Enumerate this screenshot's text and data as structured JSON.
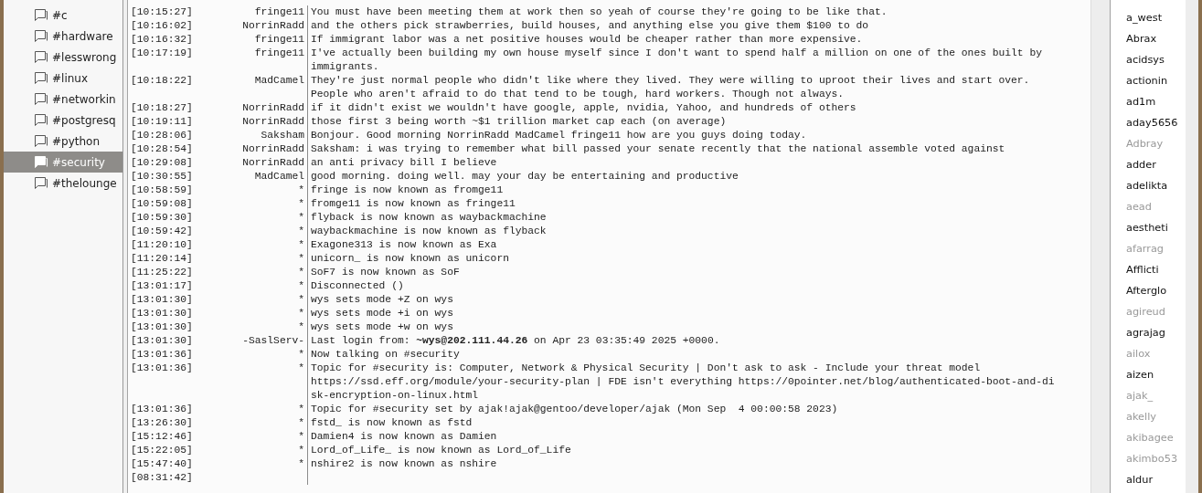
{
  "channels": [
    {
      "name": "#c",
      "selected": false
    },
    {
      "name": "#hardware",
      "selected": false
    },
    {
      "name": "#lesswrong",
      "selected": false
    },
    {
      "name": "#linux",
      "selected": false
    },
    {
      "name": "#networkin",
      "selected": false
    },
    {
      "name": "#postgresq",
      "selected": false
    },
    {
      "name": "#python",
      "selected": false
    },
    {
      "name": "#security",
      "selected": true
    },
    {
      "name": "#thelounge",
      "selected": false
    }
  ],
  "messages": [
    {
      "time": "[10:15:27]",
      "nick": "fringe11",
      "lines": [
        "You must have been meeting them at work then so yeah of course they're going to be like that."
      ]
    },
    {
      "time": "[10:16:02]",
      "nick": "NorrinRadd",
      "lines": [
        "and the others pick strawberries, build houses, and anything else you give them $100 to do"
      ]
    },
    {
      "time": "[10:16:32]",
      "nick": "fringe11",
      "lines": [
        "If immigrant labor was a net positive houses would be cheaper rather than more expensive."
      ]
    },
    {
      "time": "[10:17:19]",
      "nick": "fringe11",
      "lines": [
        "I've actually been building my own house myself since I don't want to spend half a million on one of the ones built by",
        "immigrants."
      ]
    },
    {
      "time": "[10:18:22]",
      "nick": "MadCamel",
      "lines": [
        "They're just normal people who didn't like where they lived. They were willing to uproot their lives and start over.",
        "People who aren't afraid to do that tend to be tough, hard workers. Though not always."
      ]
    },
    {
      "time": "[10:18:27]",
      "nick": "NorrinRadd",
      "lines": [
        "if it didn't exist we wouldn't have google, apple, nvidia, Yahoo, and hundreds of others"
      ]
    },
    {
      "time": "[10:19:11]",
      "nick": "NorrinRadd",
      "lines": [
        "those first 3 being worth ~$1 trillion market cap each (on average)"
      ]
    },
    {
      "time": "[10:28:06]",
      "nick": "Saksham",
      "lines": [
        "Bonjour. Good morning NorrinRadd MadCamel fringe11 how are you guys doing today."
      ]
    },
    {
      "time": "[10:28:54]",
      "nick": "NorrinRadd",
      "lines": [
        "Saksham: i was trying to remember what bill passed your senate recently that the national assemble voted against"
      ]
    },
    {
      "time": "[10:29:08]",
      "nick": "NorrinRadd",
      "lines": [
        "an anti privacy bill I believe"
      ]
    },
    {
      "time": "[10:30:55]",
      "nick": "MadCamel",
      "lines": [
        "good morning. doing well. may your day be entertaining and productive"
      ]
    },
    {
      "time": "[10:58:59]",
      "nick": "*",
      "lines": [
        "fringe is now known as fromge11"
      ]
    },
    {
      "time": "[10:59:08]",
      "nick": "*",
      "lines": [
        "fromge11 is now known as fringe11"
      ]
    },
    {
      "time": "[10:59:30]",
      "nick": "*",
      "lines": [
        "flyback is now known as waybackmachine"
      ]
    },
    {
      "time": "[10:59:42]",
      "nick": "*",
      "lines": [
        "waybackmachine is now known as flyback"
      ]
    },
    {
      "time": "[11:20:10]",
      "nick": "*",
      "lines": [
        "Exagone313 is now known as Exa"
      ]
    },
    {
      "time": "[11:20:14]",
      "nick": "*",
      "lines": [
        "unicorn_ is now known as unicorn"
      ]
    },
    {
      "time": "[11:25:22]",
      "nick": "*",
      "lines": [
        "SoF7 is now known as SoF"
      ]
    },
    {
      "time": "[13:01:17]",
      "nick": "*",
      "lines": [
        "Disconnected ()"
      ]
    },
    {
      "time": "[13:01:30]",
      "nick": "*",
      "lines": [
        "wys sets mode +Z on wys"
      ]
    },
    {
      "time": "[13:01:30]",
      "nick": "*",
      "lines": [
        "wys sets mode +i on wys"
      ]
    },
    {
      "time": "[13:01:30]",
      "nick": "*",
      "lines": [
        "wys sets mode +w on wys"
      ]
    },
    {
      "time": "[13:01:30]",
      "nick": "-SaslServ-",
      "lines": [
        "Last login from: **~wys@202.111.44.26** on Apr 23 03:35:49 2025 +0000."
      ]
    },
    {
      "time": "[13:01:36]",
      "nick": "*",
      "lines": [
        "Now talking on #security"
      ]
    },
    {
      "time": "[13:01:36]",
      "nick": "*",
      "lines": [
        "Topic for #security is: Computer, Network & Physical Security | Don't ask to ask - Include your threat model",
        "https://ssd.eff.org/module/your-security-plan | FDE isn't everything https://0pointer.net/blog/authenticated-boot-and-di",
        "sk-encryption-on-linux.html"
      ]
    },
    {
      "time": "[13:01:36]",
      "nick": "*",
      "lines": [
        "Topic for #security set by ajak!ajak@gentoo/developer/ajak (Mon Sep  4 00:00:58 2023)"
      ]
    },
    {
      "time": "[13:26:30]",
      "nick": "*",
      "lines": [
        "fstd_ is now known as fstd"
      ]
    },
    {
      "time": "[15:12:46]",
      "nick": "*",
      "lines": [
        "Damien4 is now known as Damien"
      ]
    },
    {
      "time": "[15:22:05]",
      "nick": "*",
      "lines": [
        "Lord_of_Life_ is now known as Lord_of_Life"
      ]
    },
    {
      "time": "[15:47:40]",
      "nick": "*",
      "lines": [
        "nshire2 is now known as nshire"
      ]
    },
    {
      "time": "[08:31:42]"
    }
  ],
  "users": [
    {
      "name": "a_west",
      "away": false
    },
    {
      "name": "Abrax",
      "away": false
    },
    {
      "name": "acidsys",
      "away": false
    },
    {
      "name": "actionin",
      "away": false
    },
    {
      "name": "ad1m",
      "away": false
    },
    {
      "name": "aday5656",
      "away": false
    },
    {
      "name": "Adbray",
      "away": true
    },
    {
      "name": "adder",
      "away": false
    },
    {
      "name": "adelikta",
      "away": false
    },
    {
      "name": "aead",
      "away": true
    },
    {
      "name": "aestheti",
      "away": false
    },
    {
      "name": "afarrag",
      "away": true
    },
    {
      "name": "Afflicti",
      "away": false
    },
    {
      "name": "Afterglo",
      "away": false
    },
    {
      "name": "agireud",
      "away": true
    },
    {
      "name": "agrajag",
      "away": false
    },
    {
      "name": "ailox",
      "away": true
    },
    {
      "name": "aizen",
      "away": false
    },
    {
      "name": "ajak_",
      "away": true
    },
    {
      "name": "akelly",
      "away": true
    },
    {
      "name": "akibagee",
      "away": true
    },
    {
      "name": "akimbo53",
      "away": true
    },
    {
      "name": "aldur",
      "away": false
    }
  ]
}
